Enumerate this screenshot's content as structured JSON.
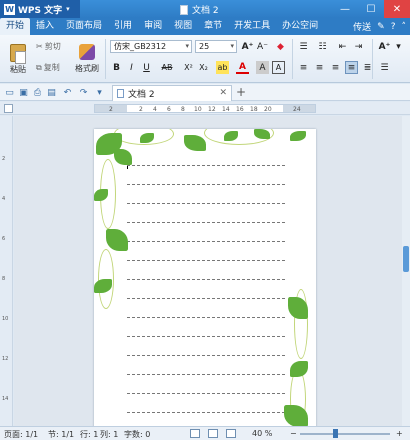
{
  "app": {
    "name": "WPS 文字",
    "doc_title": "文档 2"
  },
  "menu": {
    "tabs": [
      "开始",
      "插入",
      "页面布局",
      "引用",
      "审阅",
      "视图",
      "章节",
      "开发工具",
      "办公空间"
    ],
    "active_index": 0,
    "right_items": [
      "传送",
      "?"
    ]
  },
  "ribbon": {
    "paste_label": "粘贴",
    "cut_label": "剪切",
    "copy_label": "复制",
    "format_painter_label": "格式刷",
    "font_name": "仿宋_GB2312",
    "font_size": "25",
    "bold": "B",
    "italic": "I",
    "underline": "U",
    "strike": "AB",
    "superscript": "X²",
    "subscript": "X₂",
    "font_color_letter": "A",
    "char_shade_letter": "A",
    "grow_font": "A⁺",
    "highlight": "ab",
    "style_label": "A⁺",
    "style_dd": "▾"
  },
  "doc_tab": {
    "label": "文档 2"
  },
  "ruler": {
    "marks": [
      "2",
      "2",
      "4",
      "6",
      "8",
      "10",
      "12",
      "14",
      "16",
      "18",
      "20",
      "24"
    ]
  },
  "status": {
    "page": "页面: 1/1",
    "section": "节: 1/1",
    "row": "行: 1",
    "col": "列: 1",
    "words": "字数: 0",
    "zoom": "40 %"
  },
  "colors": {
    "accent": "#2e7cc5",
    "leaf": "#5fae3a",
    "vine": "#c2d67a"
  }
}
